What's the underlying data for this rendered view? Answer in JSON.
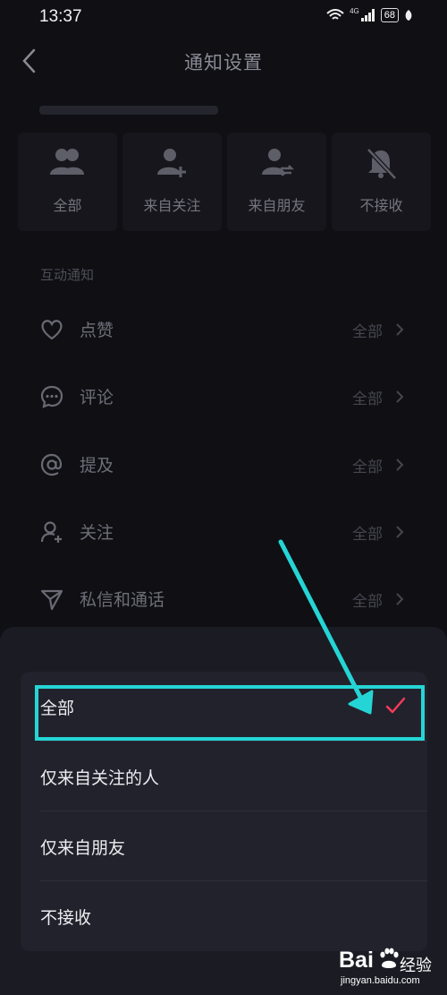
{
  "status_bar": {
    "time": "13:37",
    "network": "4G",
    "battery": "68"
  },
  "header": {
    "title": "通知设置"
  },
  "options": [
    {
      "label": "全部",
      "icon": "group-icon"
    },
    {
      "label": "来自关注",
      "icon": "add-user-icon"
    },
    {
      "label": "来自朋友",
      "icon": "friend-swap-icon"
    },
    {
      "label": "不接收",
      "icon": "bell-off-icon"
    }
  ],
  "section": {
    "label": "互动通知"
  },
  "rows": [
    {
      "label": "点赞",
      "value": "全部",
      "icon": "heart-icon"
    },
    {
      "label": "评论",
      "value": "全部",
      "icon": "comment-icon"
    },
    {
      "label": "提及",
      "value": "全部",
      "icon": "at-icon"
    },
    {
      "label": "关注",
      "value": "全部",
      "icon": "follow-icon"
    },
    {
      "label": "私信和通话",
      "value": "全部",
      "icon": "send-icon"
    }
  ],
  "sheet": {
    "items": [
      {
        "label": "全部",
        "selected": true
      },
      {
        "label": "仅来自关注的人",
        "selected": false
      },
      {
        "label": "仅来自朋友",
        "selected": false
      },
      {
        "label": "不接收",
        "selected": false
      }
    ]
  },
  "colors": {
    "highlight": "#25d5d5",
    "check": "#ff3a5c"
  },
  "watermark": {
    "brand": "Bai",
    "product": "经验",
    "url": "jingyan.baidu.com"
  }
}
